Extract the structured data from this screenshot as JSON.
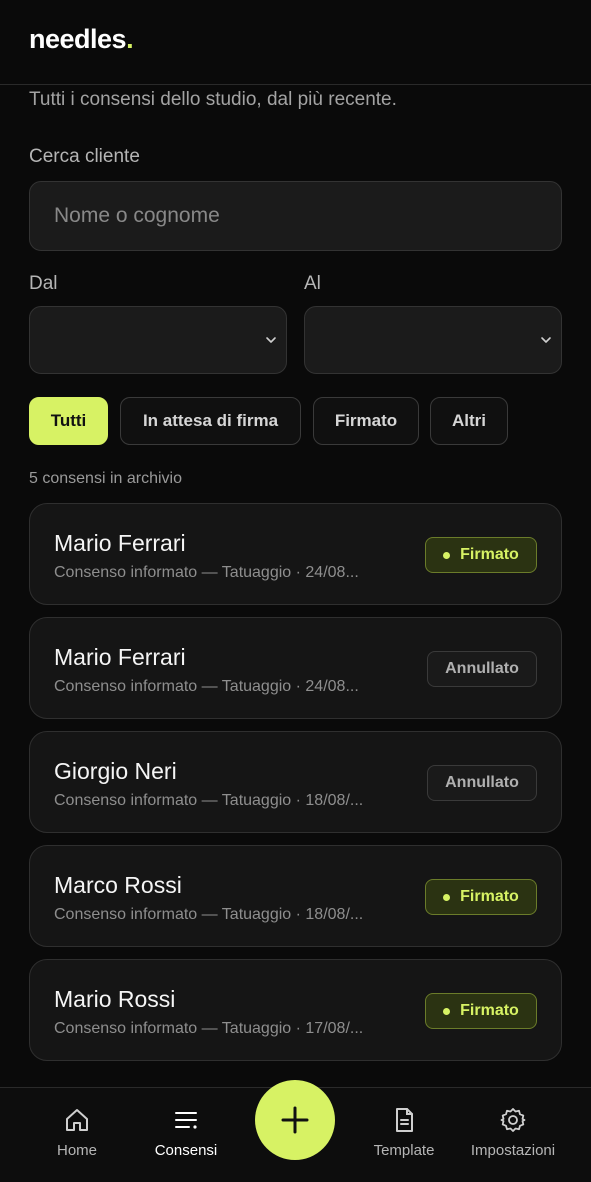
{
  "header": {
    "logo_text": "needles",
    "logo_dot": "."
  },
  "page": {
    "subtitle": "Tutti i consensi dello studio, dal più recente."
  },
  "search": {
    "label": "Cerca cliente",
    "placeholder": "Nome o cognome"
  },
  "date_filter": {
    "from_label": "Dal",
    "to_label": "Al"
  },
  "filters": [
    {
      "label": "Tutti",
      "active": true
    },
    {
      "label": "In attesa di firma",
      "active": false
    },
    {
      "label": "Firmato",
      "active": false
    },
    {
      "label": "Altri",
      "active": false
    }
  ],
  "list": {
    "count_text": "5 consensi in archivio",
    "items": [
      {
        "name": "Mario Ferrari",
        "desc": "Consenso informato — Tatuaggio · 24/08...",
        "status": "Firmato",
        "status_type": "signed"
      },
      {
        "name": "Mario Ferrari",
        "desc": "Consenso informato — Tatuaggio · 24/08...",
        "status": "Annullato",
        "status_type": "cancelled"
      },
      {
        "name": "Giorgio Neri",
        "desc": "Consenso informato — Tatuaggio · 18/08/...",
        "status": "Annullato",
        "status_type": "cancelled"
      },
      {
        "name": "Marco Rossi",
        "desc": "Consenso informato — Tatuaggio · 18/08/...",
        "status": "Firmato",
        "status_type": "signed"
      },
      {
        "name": "Mario Rossi",
        "desc": "Consenso informato — Tatuaggio · 17/08/...",
        "status": "Firmato",
        "status_type": "signed"
      }
    ]
  },
  "nav": {
    "home": "Home",
    "consensi": "Consensi",
    "template": "Template",
    "impostazioni": "Impostazioni",
    "active": "consensi"
  },
  "colors": {
    "accent": "#d7f264",
    "background": "#0a0a0a",
    "card": "#151515"
  },
  "icons": [
    "home-icon",
    "list-icon",
    "plus-icon",
    "document-icon",
    "gear-icon",
    "chevron-down-icon"
  ]
}
